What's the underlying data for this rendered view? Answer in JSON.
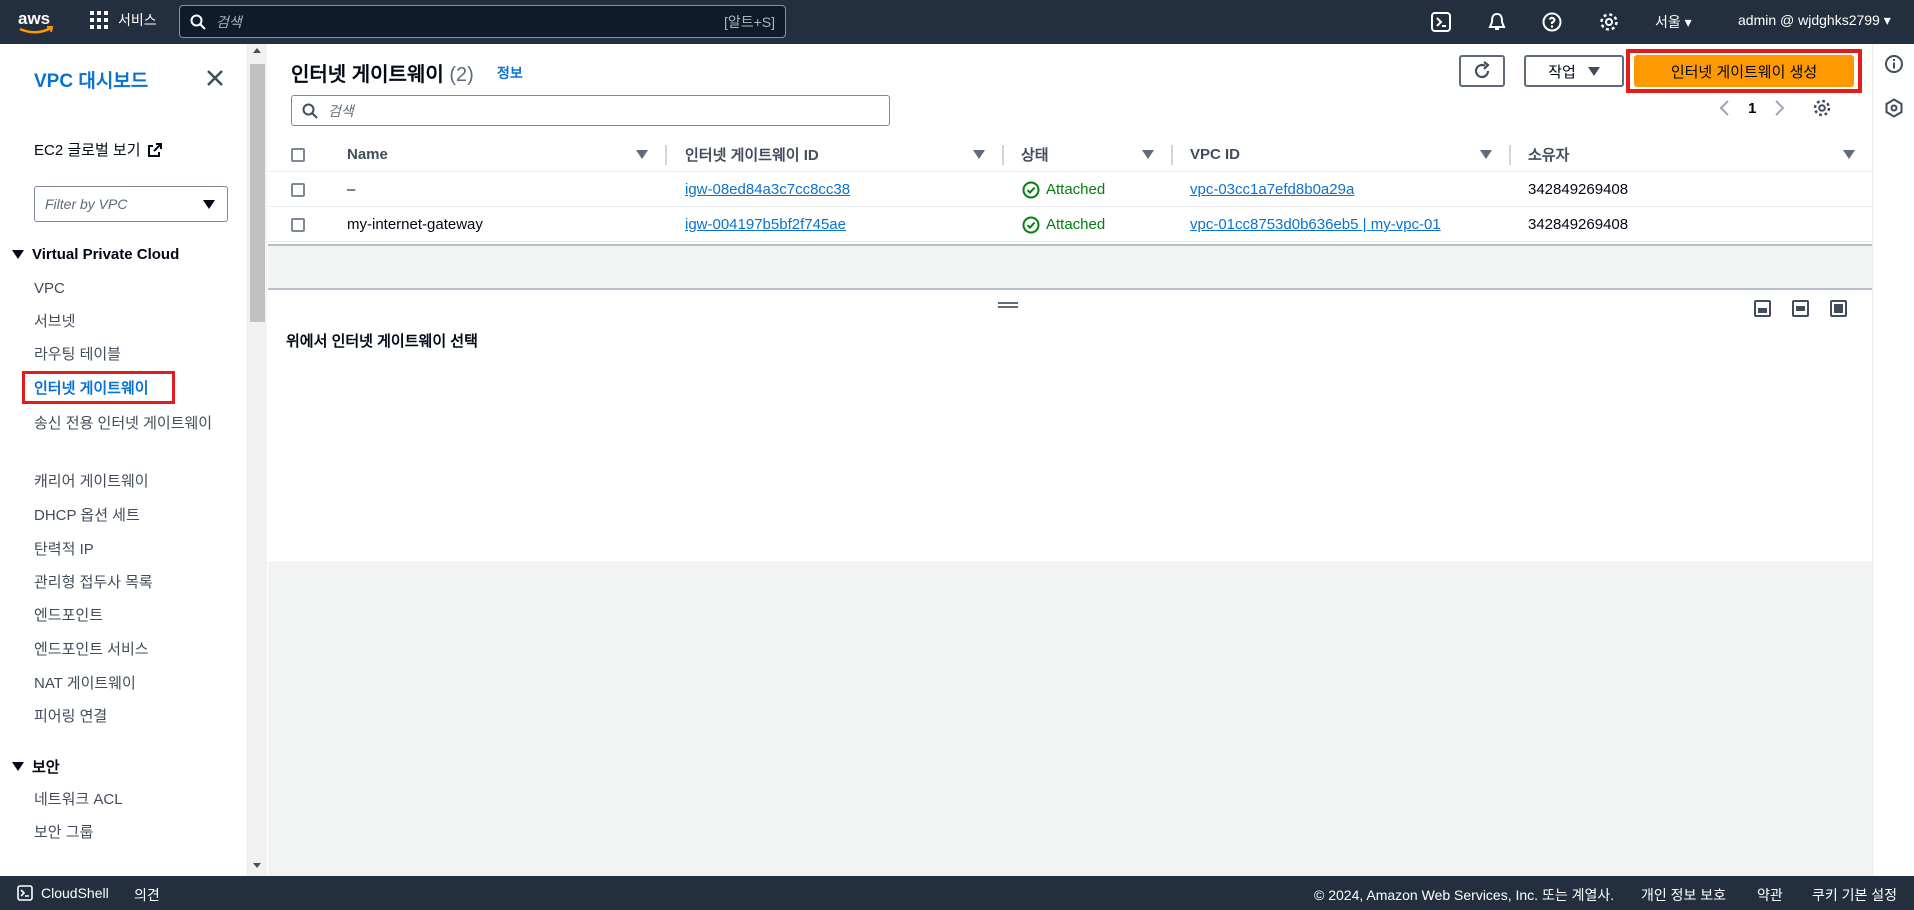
{
  "topbar": {
    "logo_text": "aws",
    "services_label": "서비스",
    "search_placeholder": "검색",
    "search_shortcut": "[알트+S]",
    "region": "서울",
    "account": "admin @ wjdghks2799"
  },
  "sidebar": {
    "title": "VPC 대시보드",
    "ec2_link": "EC2 글로벌 보기",
    "vpc_filter_placeholder": "Filter by VPC",
    "section_vpc": "Virtual Private Cloud",
    "items": [
      "VPC",
      "서브넷",
      "라우팅 테이블",
      "인터넷 게이트웨이",
      "송신 전용 인터넷 게이트웨이",
      "캐리어 게이트웨이",
      "DHCP 옵션 세트",
      "탄력적 IP",
      "관리형 접두사 목록",
      "엔드포인트",
      "엔드포인트 서비스",
      "NAT 게이트웨이",
      "피어링 연결"
    ],
    "active_index": 3,
    "section_security": "보안",
    "security_items": [
      "네트워크 ACL",
      "보안 그룹"
    ]
  },
  "panel": {
    "title": "인터넷 게이트웨이",
    "count": "(2)",
    "info": "정보",
    "actions_label": "작업",
    "create_label": "인터넷 게이트웨이 생성",
    "search_placeholder": "검색",
    "page": "1"
  },
  "table": {
    "columns": [
      "Name",
      "인터넷 게이트웨이 ID",
      "상태",
      "VPC ID",
      "소유자"
    ],
    "rows": [
      {
        "name": "–",
        "igw_id": "igw-08ed84a3c7cc8cc38",
        "status": "Attached",
        "vpc_id": "vpc-03cc1a7efd8b0a29a",
        "owner": "342849269408"
      },
      {
        "name": "my-internet-gateway",
        "igw_id": "igw-004197b5bf2f745ae",
        "status": "Attached",
        "vpc_id": "vpc-01cc8753d0b636eb5 | my-vpc-01",
        "owner": "342849269408"
      }
    ]
  },
  "lower": {
    "message": "위에서 인터넷 게이트웨이 선택"
  },
  "footer": {
    "cloudshell": "CloudShell",
    "feedback": "의견",
    "copyright": "© 2024, Amazon Web Services, Inc. 또는 계열사.",
    "privacy": "개인 정보 보호",
    "terms": "약관",
    "cookies": "쿠키 기본 설정"
  },
  "colors": {
    "nav_bg": "#232f3e",
    "link": "#0972d3",
    "primary": "#ff9900",
    "success": "#037f0c",
    "highlight": "#e31b1b"
  }
}
